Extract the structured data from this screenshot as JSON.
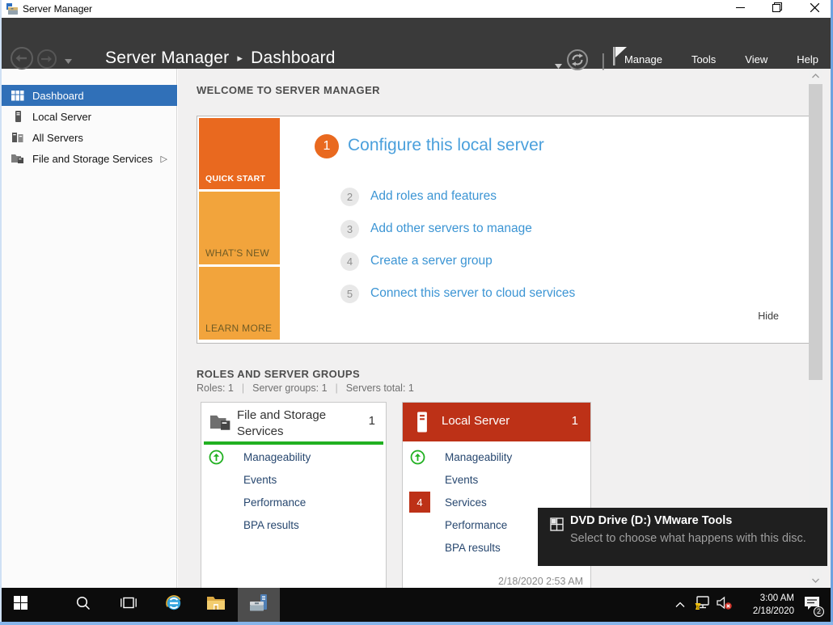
{
  "window": {
    "title": "Server Manager"
  },
  "navbar": {
    "breadcrumb": {
      "root": "Server Manager",
      "separator": "▸",
      "current": "Dashboard"
    },
    "separator": "|",
    "menus": [
      {
        "label": "Manage"
      },
      {
        "label": "Tools"
      },
      {
        "label": "View"
      },
      {
        "label": "Help"
      }
    ]
  },
  "sidebar": {
    "items": [
      {
        "label": "Dashboard",
        "selected": true
      },
      {
        "label": "Local Server",
        "selected": false
      },
      {
        "label": "All Servers",
        "selected": false
      },
      {
        "label": "File and Storage Services",
        "selected": false,
        "expander": "▷"
      }
    ]
  },
  "welcome": {
    "heading": "WELCOME TO SERVER MANAGER",
    "tabs": [
      {
        "label": "QUICK START"
      },
      {
        "label": "WHAT'S NEW"
      },
      {
        "label": "LEARN MORE"
      }
    ],
    "steps": [
      {
        "number": "1",
        "label": "Configure this local server"
      },
      {
        "number": "2",
        "label": "Add roles and features"
      },
      {
        "number": "3",
        "label": "Add other servers to manage"
      },
      {
        "number": "4",
        "label": "Create a server group"
      },
      {
        "number": "5",
        "label": "Connect this server to cloud services"
      }
    ],
    "hide_label": "Hide"
  },
  "roles": {
    "heading": "ROLES AND SERVER GROUPS",
    "stats_separator": "|",
    "stats": [
      {
        "label": "Roles: 1"
      },
      {
        "label": "Server groups: 1"
      },
      {
        "label": "Servers total: 1"
      }
    ],
    "tiles": [
      {
        "title": "File and Storage Services",
        "count": "1",
        "accent": "#21b021",
        "rows": [
          {
            "label": "Manageability"
          },
          {
            "label": "Events"
          },
          {
            "label": "Performance"
          },
          {
            "label": "BPA results"
          }
        ]
      },
      {
        "title": "Local Server",
        "count": "1",
        "accent": "#bd3117",
        "rows": [
          {
            "label": "Manageability"
          },
          {
            "label": "Events"
          },
          {
            "label": "Services",
            "badge": "4"
          },
          {
            "label": "Performance"
          },
          {
            "label": "BPA results"
          }
        ],
        "footer": "2/18/2020 2:53 AM"
      }
    ]
  },
  "toast": {
    "title": "DVD Drive (D:) VMware Tools",
    "body": "Select to choose what happens with this disc."
  },
  "taskbar": {
    "clock": {
      "time": "3:00 AM",
      "date": "2/18/2020"
    },
    "notification_badge": "2"
  },
  "colors": {
    "accent_orange": "#e9691f",
    "accent_orange_light": "#f2a43c",
    "accent_red": "#bd3117",
    "accent_green": "#21b021",
    "link_blue": "#3c95d4",
    "selected_blue": "#3070b8",
    "navbar_gray": "#3a3a3a"
  }
}
